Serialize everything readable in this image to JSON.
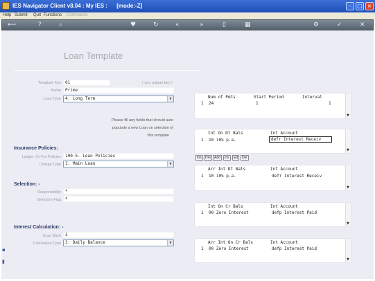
{
  "window": {
    "title": "IES Navigator Client v8.04 : My IES :      [mode:-Z]"
  },
  "menu": {
    "items": [
      "Help",
      "Submit",
      "Quit",
      "Functions"
    ],
    "disabled_item": "Commands"
  },
  "toolbar": {
    "icons": [
      "back-arrow",
      "help",
      "search",
      "heart",
      "refresh",
      "rewind",
      "fast-forward",
      "document",
      "grid",
      "gear",
      "check",
      "close"
    ]
  },
  "page": {
    "heading": "Loan Template"
  },
  "form": {
    "template_key": {
      "label": "Template Key",
      "value": "01",
      "hint": "( any unique key )"
    },
    "name": {
      "label": "Name",
      "value": "Prime"
    },
    "loan_type": {
      "label": "Loan Type",
      "value": "4: Long Term"
    },
    "note_lines": [
      "Please fill any fields that should auto",
      "populate a new Loan on selection of",
      "this template"
    ],
    "insurance_heading": "Insurance Policies:",
    "ledger_cr": {
      "label": "Ledger -Cr For Policies",
      "value": "100-5- Loan Policies"
    },
    "charge_type": {
      "label": "Charge Type",
      "value": "1: Main Loan"
    },
    "selection_heading": "Selection: -",
    "responsibility": {
      "label": "Responsibility",
      "value": "*"
    },
    "selection_flag": {
      "label": "Selection Flag",
      "value": "*"
    },
    "interest_heading": "Interest Calculation: -",
    "scan_back": {
      "label": "Scan Back",
      "value": "3"
    },
    "calculation_type": {
      "label": "Calculation Type",
      "value": "3: Daily Balance"
    }
  },
  "grids": {
    "payments": {
      "headers": [
        "Num of Pmts",
        "Start Period",
        "Interval"
      ],
      "row": [
        "1",
        "24",
        "1",
        "1"
      ]
    },
    "int_on_dt": {
      "headers": [
        "Int On Dt Bals",
        "Int Account"
      ],
      "row": [
        "1",
        "10 10% p.a.",
        "defr Interest Receiv"
      ]
    },
    "buttons": [
      "Ins",
      "Dre",
      "Add",
      "Ins",
      "Ed",
      "Del"
    ],
    "arr_int_on_dt": {
      "headers": [
        "Arr Int Dt Bals",
        "Int Account"
      ],
      "row": [
        "1",
        "10 10% p.a.",
        "defr Interest Receiv"
      ]
    },
    "int_on_cr": {
      "headers": [
        "Int On Cr Bals",
        "Int Account"
      ],
      "row": [
        "1",
        "00 Zero Interest",
        "defp Interest Paid"
      ]
    },
    "arr_int_on_cr": {
      "headers": [
        "Arr Int On Cr Bals",
        "Int Account"
      ],
      "row": [
        "1",
        "00 Zero Interest",
        "defp Interest Paid"
      ]
    }
  },
  "colors": {
    "titlebar": "#2a5cc8",
    "page_bg": "#ececf4",
    "toolbar": "#6a7580"
  }
}
